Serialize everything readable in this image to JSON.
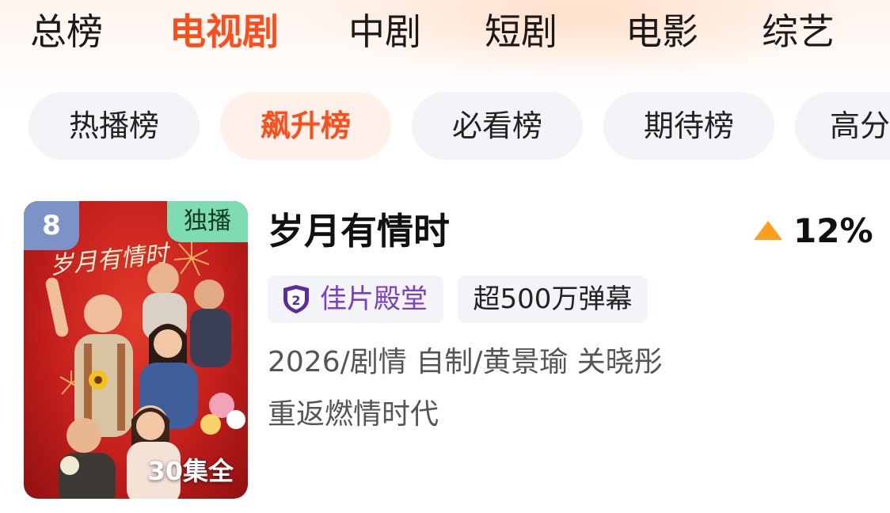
{
  "category_tabs": [
    {
      "label": "总榜",
      "active": false
    },
    {
      "label": "电视剧",
      "active": true
    },
    {
      "label": "中剧",
      "active": false
    },
    {
      "label": "短剧",
      "active": false
    },
    {
      "label": "电影",
      "active": false
    },
    {
      "label": "综艺",
      "active": false
    }
  ],
  "ranking_chips": [
    {
      "label": "热播榜",
      "active": false
    },
    {
      "label": "飙升榜",
      "active": true
    },
    {
      "label": "必看榜",
      "active": false
    },
    {
      "label": "期待榜",
      "active": false
    },
    {
      "label": "高分",
      "active": false
    }
  ],
  "show": {
    "rank": "8",
    "exclusive_badge": "独播",
    "episodes": "30集全",
    "poster_title_art": "岁月有情时",
    "title": "岁月有情时",
    "trend": {
      "direction": "up",
      "value": "12%",
      "icon": "triangle-up-icon",
      "color": "#ff9d1c"
    },
    "tags": [
      {
        "icon": "hall-of-fame-shield-icon",
        "label": "佳片殿堂",
        "color": "#7b3fc4"
      },
      {
        "label": "超500万弹幕"
      }
    ],
    "meta": "2026/剧情 自制/黄景瑜 关晓彤",
    "tagline": "重返燃情时代"
  },
  "colors": {
    "accent": "#ff4d1a",
    "chip_bg": "#f2f4f8",
    "active_chip_bg": "#fff0ea",
    "rank_badge": "#7d93c7",
    "exclusive_badge": "#7fdcb2",
    "poster_red": "#c41f1c"
  }
}
